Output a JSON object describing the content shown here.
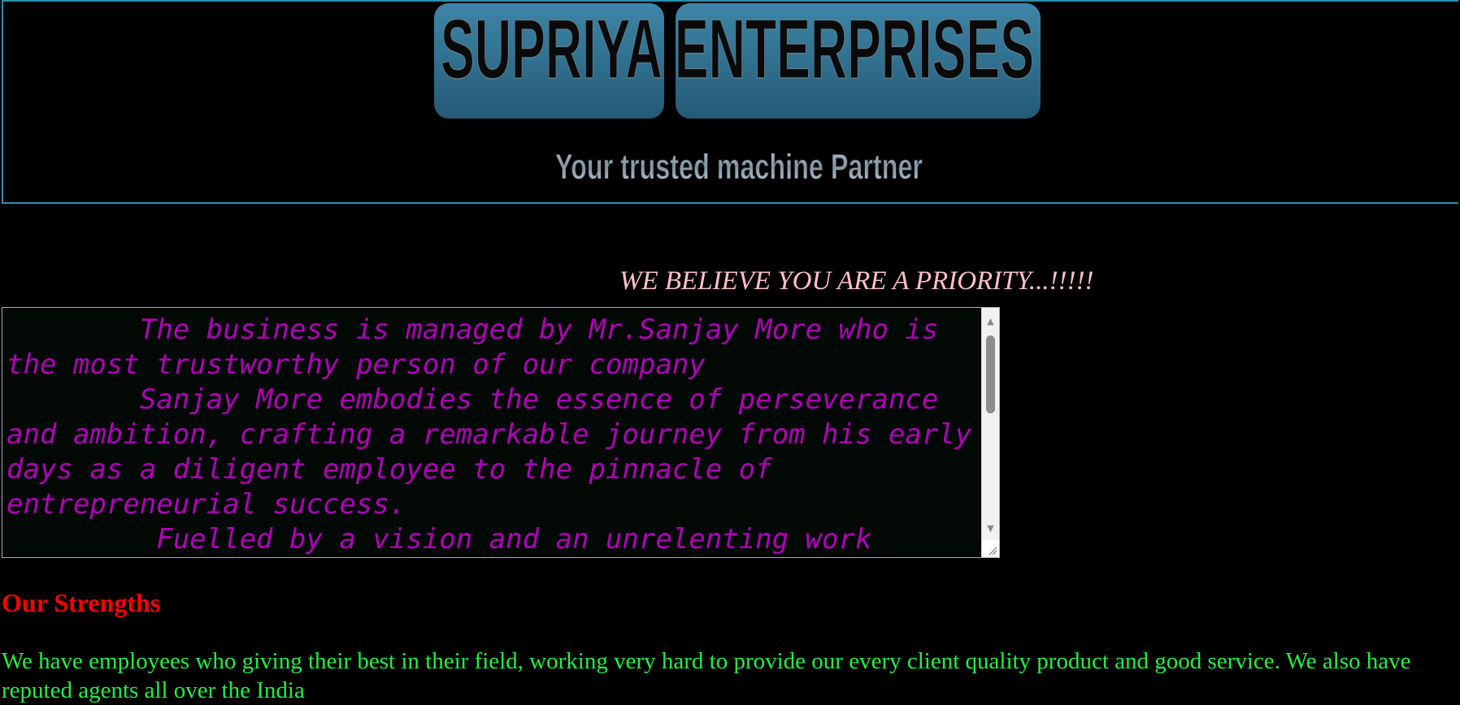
{
  "header": {
    "brand_name": "SUPRIYA ENTERPRISES",
    "tagline": "Your trusted machine Partner",
    "colors": {
      "brand": "#2e6e8e",
      "border": "#2a8fa6"
    }
  },
  "priority_banner": "WE BELIEVE YOU ARE A PRIORITY...!!!!!",
  "about": {
    "text": "\tThe business is managed by Mr.Sanjay More who is the most trustworthy person of our company\n\tSanjay More embodies the essence of perseverance and ambition, crafting a remarkable journey from his early days as a diligent employee to the pinnacle of entrepreneurial success.\n\t Fuelled by a vision and an unrelenting work",
    "scroll_position": 0.0,
    "icons": [
      "scroll-up-arrow-icon",
      "scroll-down-arrow-icon",
      "resize-grip-icon"
    ]
  },
  "strengths": {
    "title": "Our Strengths",
    "text": "We have employees who giving their best in their field, working very hard to provide our every client quality product and good service. We also have reputed agents all over the India"
  },
  "colors": {
    "page_background": "#000000",
    "priority_text": "#ffc0cb",
    "about_text": "#b000b8",
    "strengths_title": "#ff0000",
    "strengths_text": "#22ee44"
  }
}
